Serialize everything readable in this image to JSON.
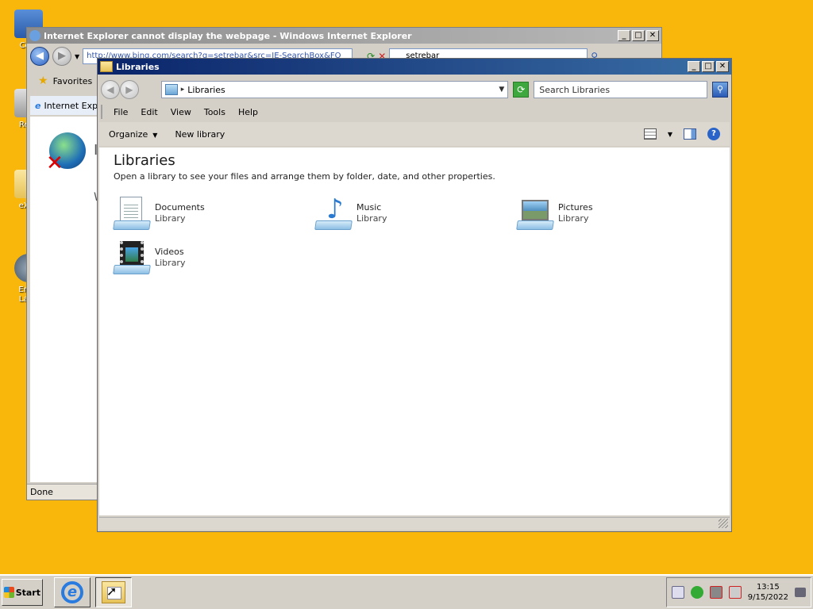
{
  "desktop": {
    "icons": [
      {
        "label": "Com"
      },
      {
        "label": "Recy"
      },
      {
        "label": "eXPe"
      },
      {
        "label": "Enab\nLaun"
      }
    ]
  },
  "ie_window": {
    "title": "Internet Explorer cannot display the webpage - Windows Internet Explorer",
    "url": "http://www.bing.com/search?q=setrebar&src=IE-SearchBox&FO",
    "search_text": "setrebar",
    "favorites_label": "Favorites",
    "tab_label": "Internet Exp",
    "content_letter_1": "I",
    "content_letter_2": "W",
    "status": "Done"
  },
  "explorer_window": {
    "title": "Libraries",
    "address": "Libraries",
    "search_placeholder": "Search Libraries",
    "menu": {
      "file": "File",
      "edit": "Edit",
      "view": "View",
      "tools": "Tools",
      "help": "Help"
    },
    "commands": {
      "organize": "Organize",
      "new_library": "New library"
    },
    "heading": "Libraries",
    "subheading": "Open a library to see your files and arrange them by folder, date, and other properties.",
    "libraries": [
      {
        "name": "Documents",
        "kind": "Library",
        "icon": "documents-library-icon"
      },
      {
        "name": "Music",
        "kind": "Library",
        "icon": "music-library-icon"
      },
      {
        "name": "Pictures",
        "kind": "Library",
        "icon": "pictures-library-icon"
      },
      {
        "name": "Videos",
        "kind": "Library",
        "icon": "videos-library-icon"
      }
    ]
  },
  "taskbar": {
    "start_label": "Start",
    "clock_time": "13:15",
    "clock_date": "9/15/2022"
  },
  "colors": {
    "desktop_bg": "#f8b70a",
    "active_title": "#0a246a",
    "inactive_title": "#8c8c8c"
  }
}
